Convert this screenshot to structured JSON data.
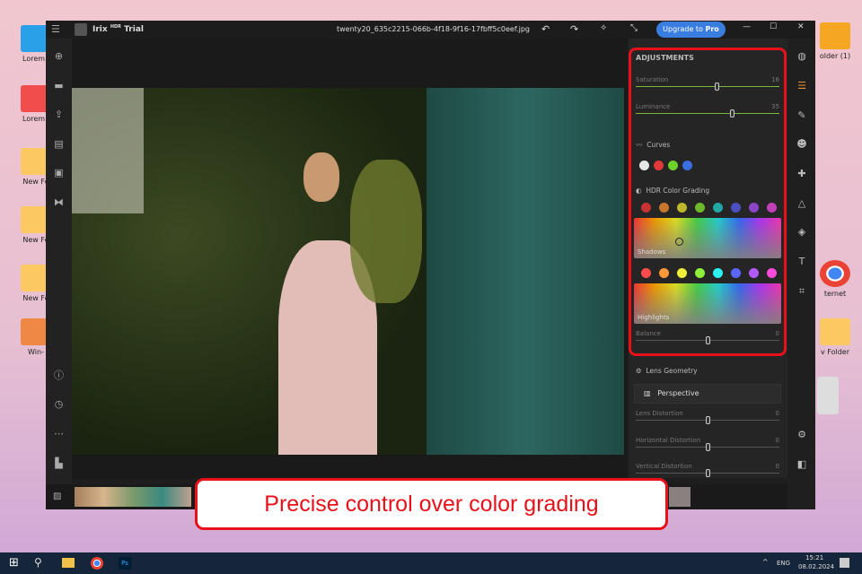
{
  "desktop": {
    "left_icons": [
      "Lorem I",
      "Lorem I",
      "New Fo",
      "New Fo",
      "New Fo",
      "Win-"
    ],
    "right_icons": [
      "older (1)",
      "ternet",
      "v Folder"
    ]
  },
  "app": {
    "name": "Irix",
    "superscript": "HDR",
    "edition": "Trial",
    "filename": "twenty20_635c2215-066b-4f18-9f16-17fbff5c0eef.jpg",
    "upgrade_label": "Upgrade to",
    "upgrade_bold": "Pro"
  },
  "panel": {
    "title": "ADJUSTMENTS",
    "saturation": {
      "label": "Saturation",
      "value": "16",
      "pos": 0.57
    },
    "luminance": {
      "label": "Luminance",
      "value": "35",
      "pos": 0.675
    },
    "curves": "Curves",
    "curve_colors": [
      "#e6e6e6",
      "#e03a3a",
      "#6ed12a",
      "#3b6fe0"
    ],
    "hdr": "HDR Color Grading",
    "shadow_dots": [
      "#c83232",
      "#c8782d",
      "#bdb82c",
      "#6fb82c",
      "#22a6a6",
      "#4b4fc0",
      "#8b44c8",
      "#c040b8"
    ],
    "highlight_dots": [
      "#ff4b4b",
      "#ff9a3a",
      "#f2ef3a",
      "#8ef03a",
      "#2ef2f2",
      "#5a66ff",
      "#b35aff",
      "#ff4bdc"
    ],
    "shadows": "Shadows",
    "highlights": "Highlights",
    "balance": {
      "label": "Balance",
      "value": "0",
      "pos": 0.5
    },
    "lens": "Lens Geometry",
    "perspective": "Perspective",
    "lens_distortion": {
      "label": "Lens Distortion",
      "value": "0",
      "pos": 0.5
    },
    "horizontal": {
      "label": "Horizontal Distortion",
      "value": "0",
      "pos": 0.5
    },
    "vertical": {
      "label": "Vertical Distortion",
      "value": "0",
      "pos": 0.5
    }
  },
  "banner": "Precise control over color grading",
  "taskbar": {
    "lang": "ENG",
    "time": "15:21",
    "date": "08.02.2024"
  },
  "accent": "#3a7de0"
}
